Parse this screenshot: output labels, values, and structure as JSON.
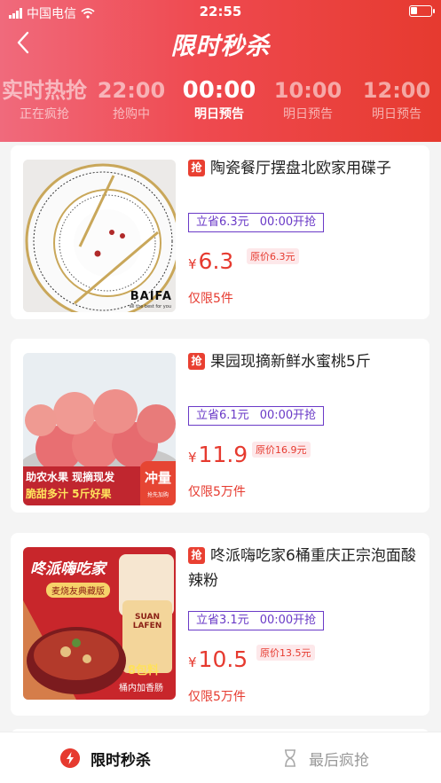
{
  "statusbar": {
    "carrier": "中国电信",
    "time": "22:55"
  },
  "header": {
    "title": "限时秒杀"
  },
  "time_slots": [
    {
      "time": "实时热抢",
      "status": "正在疯抢"
    },
    {
      "time": "22:00",
      "status": "抢购中"
    },
    {
      "time": "00:00",
      "status": "明日预告"
    },
    {
      "time": "10:00",
      "status": "明日预告"
    },
    {
      "time": "12:00",
      "status": "明日预告"
    }
  ],
  "products": [
    {
      "tag": "抢",
      "name": "陶瓷餐厅摆盘北欧家用碟子",
      "save": "立省6.3元",
      "start": "00:00开抢",
      "currency": "¥",
      "price": "6.3",
      "original": "原价6.3元",
      "limit": "仅限5件",
      "brand": "BAIFA",
      "brand_sub": "all the best for you"
    },
    {
      "tag": "抢",
      "name": "果园现摘新鲜水蜜桃5斤",
      "save": "立省6.1元",
      "start": "00:00开抢",
      "currency": "¥",
      "price": "11.9",
      "original": "原价16.9元",
      "limit": "仅限5万件",
      "banner1": "助农水果 现摘现发",
      "banner2": "脆甜多汁  5斤好果",
      "banner3": "冲量",
      "banner4": "抢先加购"
    },
    {
      "tag": "抢",
      "name": "咚派嗨吃家6桶重庆正宗泡面酸辣粉",
      "save": "立省3.1元",
      "start": "00:00开抢",
      "currency": "¥",
      "price": "10.5",
      "original": "原价13.5元",
      "limit": "仅限5万件",
      "img_title": "咚派嗨吃家",
      "img_sub": "麦烧友典藏版",
      "img_badge": "8包料",
      "img_badge2": "桶内加香肠",
      "cup_text": "SUAN LAFEN"
    }
  ],
  "tabbar": {
    "tab1": "限时秒杀",
    "tab2": "最后疯抢"
  },
  "colors": {
    "accent": "#e63a2f",
    "promo": "#6a3ac7"
  }
}
